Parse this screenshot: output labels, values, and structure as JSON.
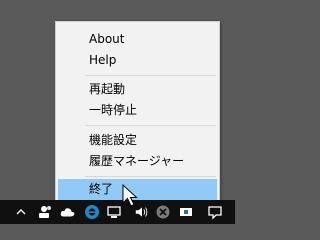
{
  "menu": {
    "items": [
      {
        "label": "About"
      },
      {
        "label": "Help"
      },
      {
        "label": "再起動"
      },
      {
        "label": "一時停止"
      },
      {
        "label": "機能設定"
      },
      {
        "label": "履歴マネージャー"
      },
      {
        "label": "終了"
      }
    ],
    "selected_index": 6,
    "highlight_color": "#91c9f7"
  },
  "taskbar": {
    "icons": [
      "chevron-up-icon",
      "people-icon",
      "cloud-icon",
      "edge-icon",
      "network-icon",
      "volume-icon",
      "stop-icon",
      "battery-icon",
      "notification-icon"
    ]
  }
}
